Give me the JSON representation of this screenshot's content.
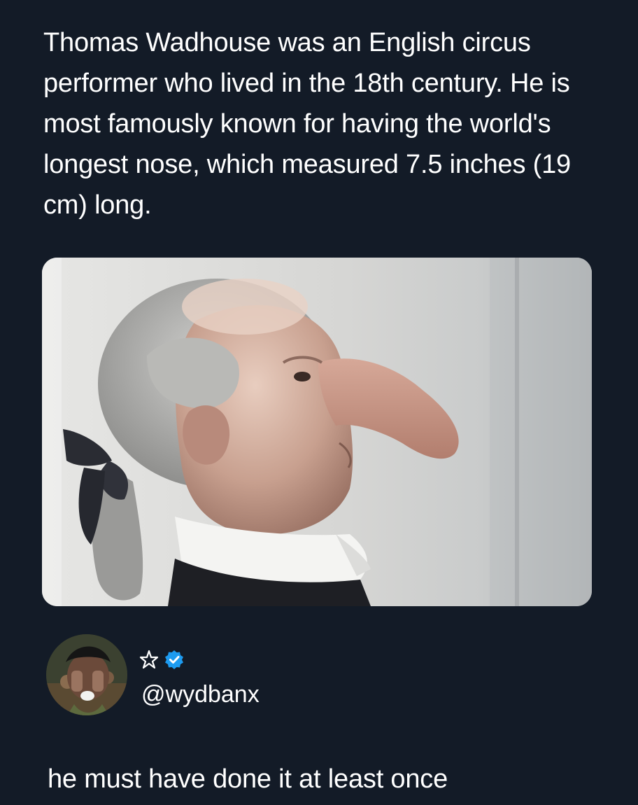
{
  "post": {
    "quoted_text": "Thomas Wadhouse was an English circus performer who lived in the 18th century. He is most famously known for having the world's longest nose, which measured 7.5 inches (19 cm) long.",
    "image_icon": "photo-image"
  },
  "author": {
    "avatar_icon": "avatar",
    "name_icon": "star-icon",
    "verified_icon": "verified-badge-icon",
    "handle": "@wydbanx",
    "verified_color": "#1d9bf0"
  },
  "reply": {
    "text": "he must have done it at least once"
  },
  "theme": {
    "background": "#131b27",
    "text": "#ffffff"
  }
}
